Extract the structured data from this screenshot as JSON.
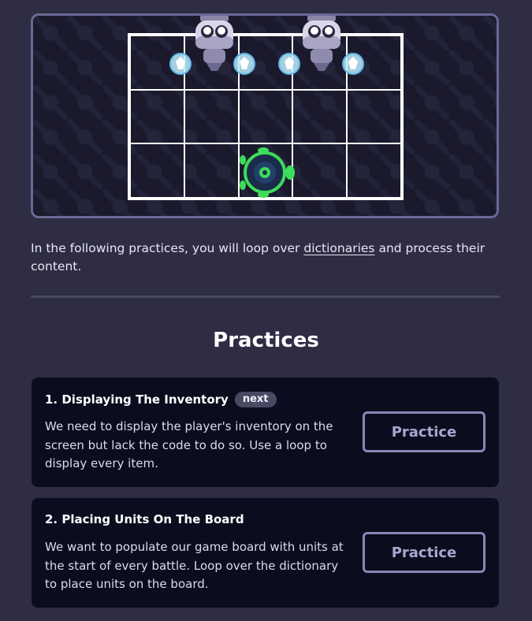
{
  "board": {
    "rows": 3,
    "columns": 5,
    "units": [
      "robot-enemy",
      "robot-enemy",
      "player-turtle"
    ],
    "colors": {
      "grid": "#ffffff",
      "frame": "#6a6894",
      "player": "#3ddc5a",
      "gem": "#9fe3ff"
    }
  },
  "intro": {
    "before_link": "In the following practices, you will loop over ",
    "link": "dictionaries",
    "after_link": " and process their content."
  },
  "section": {
    "title": "Practices"
  },
  "practices": [
    {
      "title": "1. Displaying The Inventory",
      "badge": "next",
      "description": "We need to display the player's inventory on the screen but lack the code to do so. Use a loop to display every item.",
      "button": "Practice"
    },
    {
      "title": "2. Placing Units On The Board",
      "description": "We want to populate our game board with units at the start of every battle. Loop over the dictionary to place units on the board.",
      "button": "Practice"
    }
  ]
}
